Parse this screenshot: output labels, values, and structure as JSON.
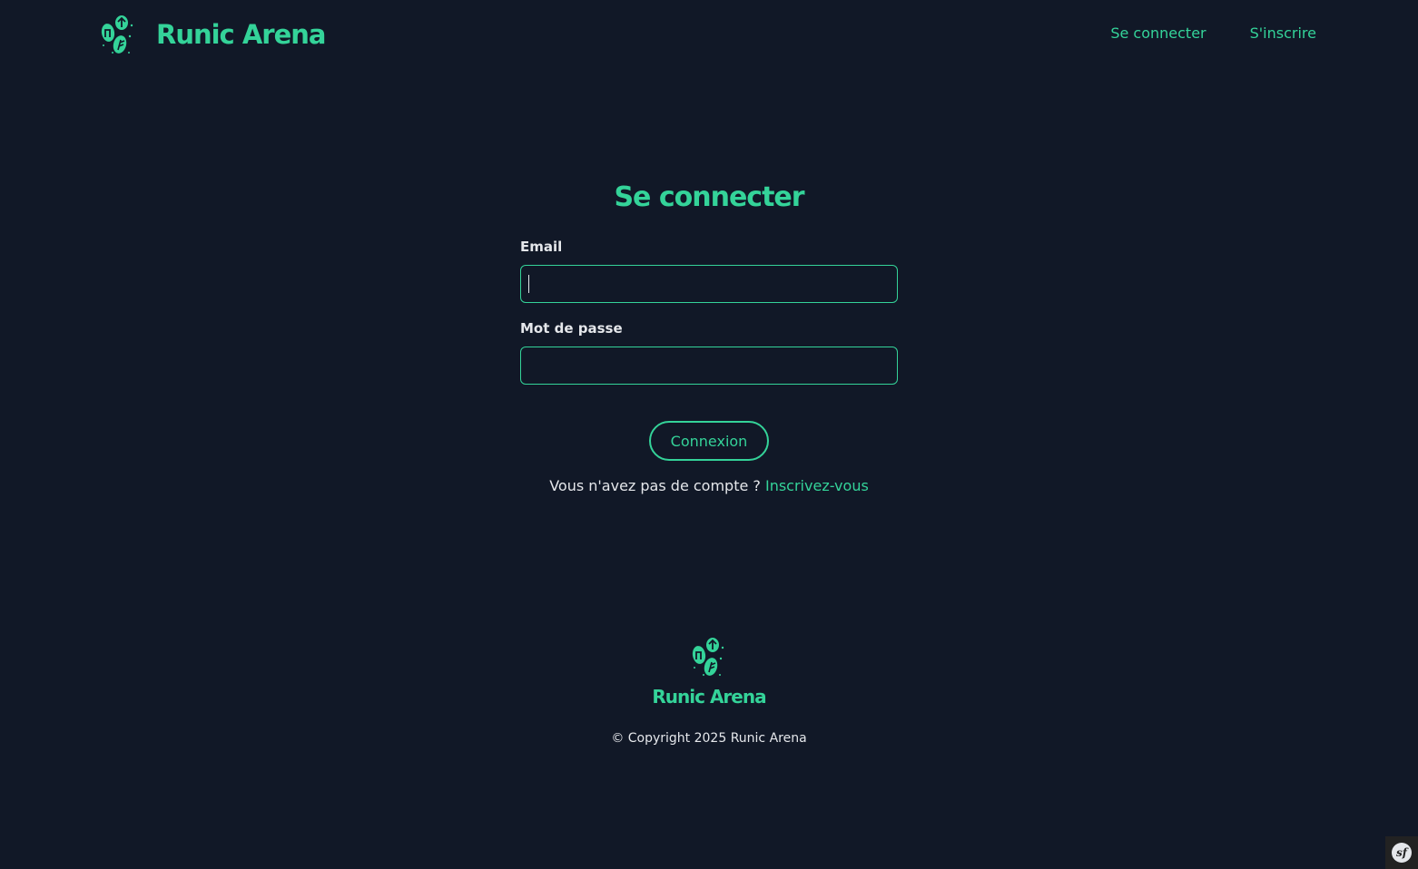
{
  "colors": {
    "background": "#111827",
    "accent": "#34d399",
    "text": "#e5e7eb"
  },
  "header": {
    "brand_name": "Runic Arena",
    "logo_icon": "rune-stones-icon",
    "nav": {
      "login": "Se connecter",
      "signup": "S'inscrire"
    }
  },
  "login_form": {
    "title": "Se connecter",
    "email_label": "Email",
    "email_value": "",
    "password_label": "Mot de passe",
    "password_value": "",
    "submit_label": "Connexion",
    "no_account_text": "Vous n'avez pas de compte ? ",
    "signup_link": "Inscrivez-vous"
  },
  "footer": {
    "brand_name": "Runic Arena",
    "copyright": "© Copyright 2025 Runic Arena"
  },
  "debug_toolbar": {
    "icon": "symfony-icon",
    "glyph": "sf"
  }
}
